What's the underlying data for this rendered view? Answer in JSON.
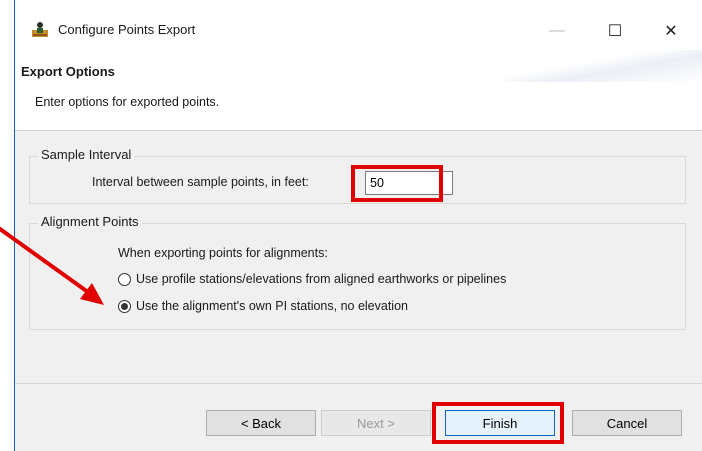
{
  "window": {
    "title": "Configure Points Export",
    "app_icon": "figure-app-icon",
    "controls": {
      "minimize": "—",
      "maximize": "☐",
      "close": "✕"
    }
  },
  "header": {
    "title": "Export Options",
    "description": "Enter options for exported points."
  },
  "sample_interval": {
    "legend": "Sample Interval",
    "label": "Interval between sample points, in feet:",
    "value": "50"
  },
  "alignment_points": {
    "legend": "Alignment Points",
    "prompt": "When exporting points for alignments:",
    "options": [
      {
        "label": "Use profile stations/elevations from aligned earthworks or pipelines",
        "checked": false
      },
      {
        "label": "Use the alignment's own PI stations, no elevation",
        "checked": true
      }
    ]
  },
  "buttons": {
    "back": "< Back",
    "next": "Next >",
    "finish": "Finish",
    "cancel": "Cancel"
  },
  "annotations": {
    "highlight_color": "#e00000",
    "arrow_color": "#e00000"
  }
}
